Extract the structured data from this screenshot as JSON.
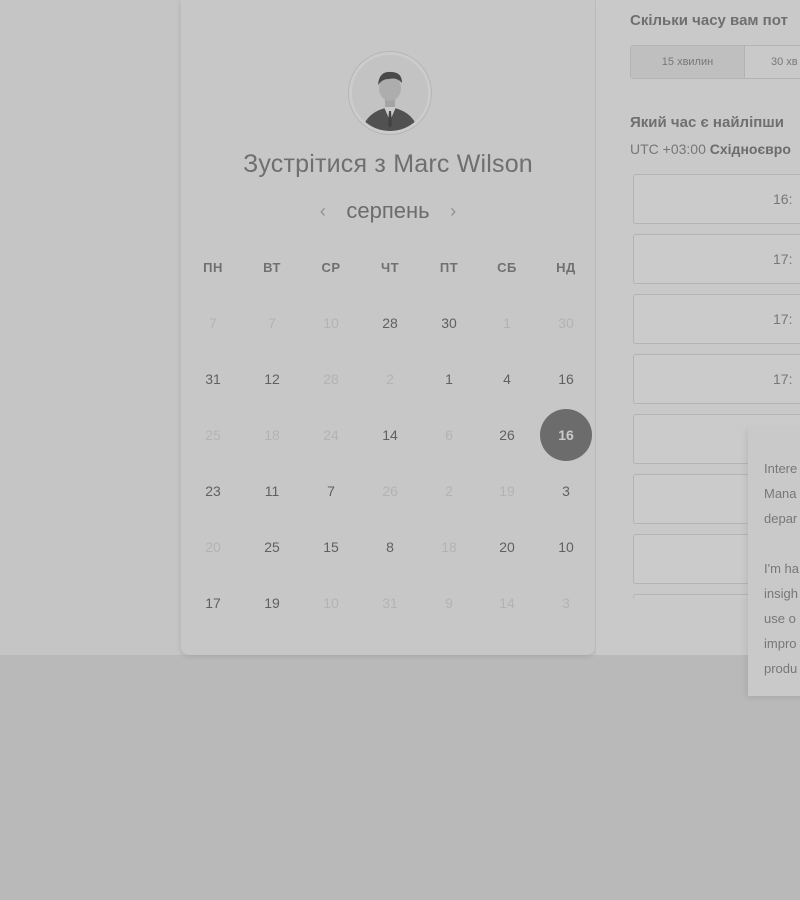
{
  "calendar": {
    "title": "Зустрітися з Marc Wilson",
    "month": "серпень",
    "prev_icon": "chevron-left-icon",
    "next_icon": "chevron-right-icon",
    "weekdays": [
      "ПН",
      "ВТ",
      "СР",
      "ЧТ",
      "ПТ",
      "СБ",
      "НД"
    ],
    "weeks": [
      [
        {
          "n": "7",
          "a": false
        },
        {
          "n": "7",
          "a": false
        },
        {
          "n": "10",
          "a": false
        },
        {
          "n": "28",
          "a": true
        },
        {
          "n": "30",
          "a": true
        },
        {
          "n": "1",
          "a": false
        },
        {
          "n": "30",
          "a": false
        }
      ],
      [
        {
          "n": "31",
          "a": true
        },
        {
          "n": "12",
          "a": true
        },
        {
          "n": "28",
          "a": false
        },
        {
          "n": "2",
          "a": false
        },
        {
          "n": "1",
          "a": true
        },
        {
          "n": "4",
          "a": true
        },
        {
          "n": "16",
          "a": true
        }
      ],
      [
        {
          "n": "25",
          "a": false
        },
        {
          "n": "18",
          "a": false
        },
        {
          "n": "24",
          "a": false
        },
        {
          "n": "14",
          "a": true
        },
        {
          "n": "6",
          "a": false
        },
        {
          "n": "26",
          "a": true
        },
        {
          "n": "16",
          "a": true,
          "selected": true
        }
      ],
      [
        {
          "n": "23",
          "a": true
        },
        {
          "n": "11",
          "a": true
        },
        {
          "n": "7",
          "a": true
        },
        {
          "n": "26",
          "a": false
        },
        {
          "n": "2",
          "a": false
        },
        {
          "n": "19",
          "a": false
        },
        {
          "n": "3",
          "a": true
        }
      ],
      [
        {
          "n": "20",
          "a": false
        },
        {
          "n": "25",
          "a": true
        },
        {
          "n": "15",
          "a": true
        },
        {
          "n": "8",
          "a": true
        },
        {
          "n": "18",
          "a": false
        },
        {
          "n": "20",
          "a": true
        },
        {
          "n": "10",
          "a": true
        }
      ],
      [
        {
          "n": "17",
          "a": true
        },
        {
          "n": "19",
          "a": true
        },
        {
          "n": "10",
          "a": false
        },
        {
          "n": "31",
          "a": false
        },
        {
          "n": "9",
          "a": false
        },
        {
          "n": "14",
          "a": false
        },
        {
          "n": "3",
          "a": false
        }
      ]
    ]
  },
  "scheduler": {
    "duration_heading": "Скільки часу вам пот",
    "durations": [
      "15 хвилин",
      "30 хв"
    ],
    "time_heading": "Який час є найліпши",
    "timezone_offset": "UTC +03:00",
    "timezone_name": "Східноєвро",
    "slots": [
      "16:",
      "17:",
      "17:",
      "17:",
      "",
      "",
      "",
      ""
    ]
  },
  "popup": {
    "lines": [
      "Intere",
      "Mana",
      "depar",
      "",
      "I'm ha",
      "insigh",
      "use o",
      "impro",
      "produ"
    ]
  }
}
